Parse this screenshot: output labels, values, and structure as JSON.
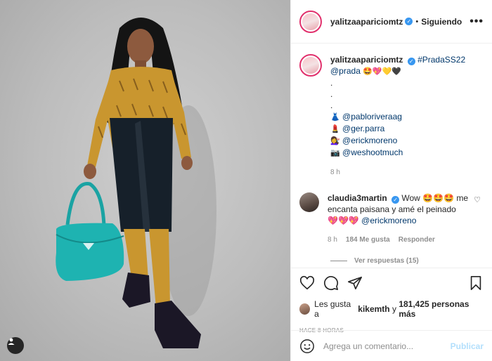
{
  "post": {
    "username": "yalitzaapariciomtz",
    "follow_status": "Siguiendo",
    "more_label": "•••"
  },
  "caption": {
    "username": "yalitzaapariciomtz",
    "hashtag": "#PradaSS22",
    "mention": "@prada",
    "emojis": "🤩💖💛🖤",
    "dot1": ".",
    "dot2": ".",
    "dot3": ".",
    "credits": [
      {
        "emoji": "👗",
        "handle": "@pabloriveraag"
      },
      {
        "emoji": "💄",
        "handle": "@ger.parra"
      },
      {
        "emoji": "💇‍♀️",
        "handle": "@erickmoreno"
      },
      {
        "emoji": "📷",
        "handle": "@weshootmuch"
      }
    ],
    "time": "8 h"
  },
  "comment": {
    "username": "claudia3martin",
    "text_a": "Wow 🤩🤩🤩",
    "text_b": "me encanta paisana y amé el",
    "text_c": "peinado 💖💖💖",
    "mention": "@erickmoreno",
    "time": "8 h",
    "likes": "184 Me gusta",
    "reply": "Responder",
    "view_replies": "Ver respuestas (15)"
  },
  "likes": {
    "prefix": "Les gusta a",
    "first": "kikemth",
    "middle": "y",
    "count": "181,425 personas más"
  },
  "posted_ago": "HACE 8 HORAS",
  "add_comment": {
    "placeholder": "Agrega un comentario...",
    "publish": "Publicar"
  },
  "colors": {
    "verified": "#3897f0",
    "link": "#00376b",
    "publish_disabled": "#b2dffc",
    "story_ring": "#e1306c"
  }
}
